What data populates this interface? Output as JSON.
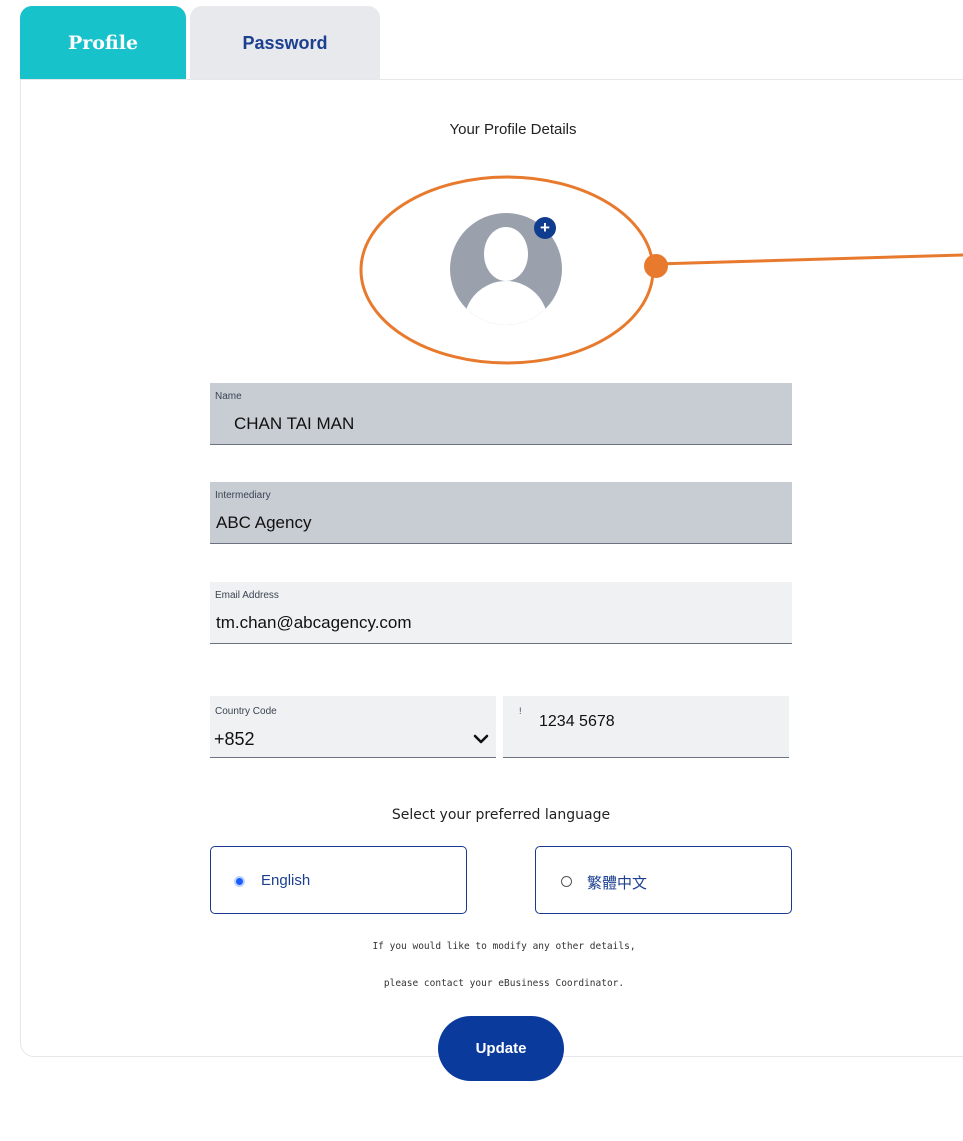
{
  "tabs": [
    {
      "label": "Profile",
      "active": true
    },
    {
      "label": "Password",
      "active": false
    }
  ],
  "page_title": "Your Profile Details",
  "avatar": {
    "icon": "user-silhouette-icon",
    "add_icon": "plus-icon",
    "add_glyph": "+"
  },
  "fields": {
    "name": {
      "label": "Name",
      "value": "CHAN TAI MAN"
    },
    "intermediary": {
      "label": "Intermediary",
      "value": "ABC Agency"
    },
    "email": {
      "label": "Email Address",
      "value": "tm.chan@abcagency.com"
    },
    "country_code": {
      "label": "Country Code",
      "value": "+852"
    },
    "phone": {
      "label": "!",
      "value": "1234 5678"
    }
  },
  "language": {
    "title": "Select your preferred language",
    "options": [
      {
        "label": "English",
        "selected": true
      },
      {
        "label": "繁體中文",
        "selected": false
      }
    ]
  },
  "note": {
    "line1": "If you would like to modify any other details,",
    "line2": "please contact your eBusiness Coordinator."
  },
  "update_button": "Update",
  "colors": {
    "accent_teal": "#17c2cb",
    "brand_navy": "#0a3b9c",
    "annotation_orange": "#e87a2e"
  }
}
